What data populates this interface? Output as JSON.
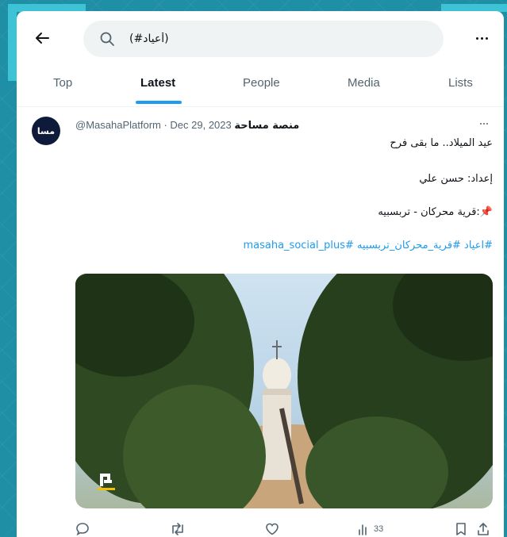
{
  "header": {
    "search_value": "(#أعياد)"
  },
  "tabs": [
    {
      "label": "Top"
    },
    {
      "label": "Latest"
    },
    {
      "label": "People"
    },
    {
      "label": "Media"
    },
    {
      "label": "Lists"
    }
  ],
  "active_tab": "Latest",
  "tweet": {
    "display_name": "منصة مساحة",
    "handle_date": "@MasahaPlatform · Dec 29, 2023",
    "avatar_text": "مسا",
    "lines": [
      "عيد الميلاد.. ما بقى فرح",
      "إعداد: حسن علي",
      "📌:قرية محركان - تربسبيه"
    ],
    "hashtags": "#اعياد #قرية_محركان_تربسبيه #masaha_social_plus",
    "stats": {
      "views": "33"
    }
  },
  "colors": {
    "accent": "#1d9bf0",
    "frame": "#1f8fa6",
    "frame_deco": "#3ec3d6"
  },
  "icons": [
    "back-arrow-icon",
    "search-icon",
    "more-icon",
    "reply-icon",
    "retweet-icon",
    "like-icon",
    "views-icon",
    "bookmark-icon",
    "share-icon"
  ]
}
